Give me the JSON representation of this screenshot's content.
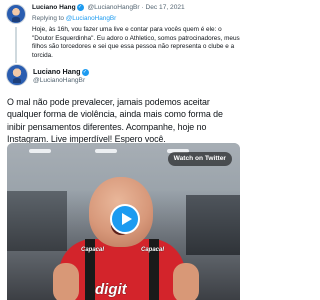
{
  "reply_tweet": {
    "author_name": "Luciano Hang",
    "author_handle": "@LucianoHangBr",
    "date": "Dec 17, 2021",
    "separator": "·",
    "replying_to_label": "Replying to",
    "replying_to_handle": "@LucianoHangBr",
    "body": "Hoje, às 16h, vou fazer uma live e contar para vocês quem é ele: o \"Doutor Esquerdinha\". Eu adoro o Athletico, somos patrocinadores, meus filhos são torcedores e sei que essa pessoa não representa o clube e a torcida."
  },
  "main_tweet": {
    "author_name": "Luciano Hang",
    "author_handle": "@LucianoHangBr",
    "body": "O mal não pode prevalecer, jamais podemos aceitar qualquer forma de violência, ainda mais como forma de inibir pensamentos diferentes. Acompanhe, hoje no Instagram. Live imperdível! Espero você.",
    "video": {
      "watch_label": "Watch on Twitter",
      "sponsor_left": "Capacal",
      "sponsor_right": "Capacal",
      "sponsor_bottom": "digit"
    }
  },
  "colors": {
    "accent": "#1d9bf0",
    "text_primary": "#0f1419",
    "text_secondary": "#536471",
    "jersey_red": "#d3242b"
  },
  "icons": {
    "verified": "verified-badge-icon",
    "play": "play-icon"
  }
}
